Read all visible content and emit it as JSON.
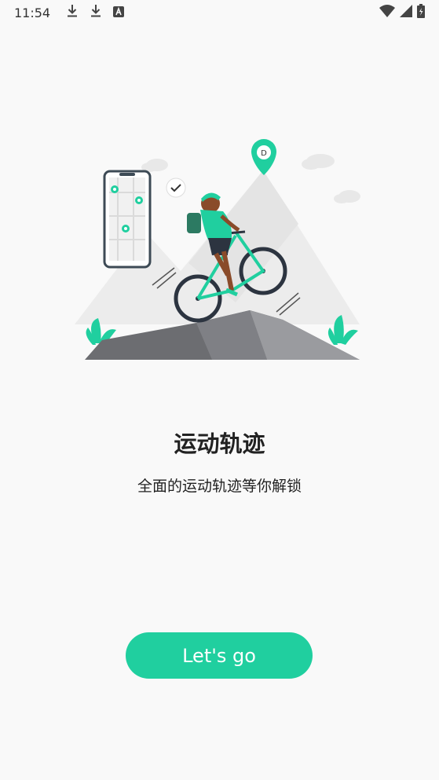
{
  "status_bar": {
    "time": "11:54",
    "icons_left": [
      "download-icon",
      "download-icon",
      "keyboard-a-icon"
    ],
    "icons_right": [
      "wifi-icon",
      "signal-icon",
      "battery-icon"
    ]
  },
  "onboarding": {
    "title": "运动轨迹",
    "subtitle": "全面的运动轨迹等你解锁",
    "button_label": "Let's go"
  },
  "colors": {
    "accent": "#20cf9f",
    "background": "#f9f9f9",
    "text": "#222222"
  }
}
